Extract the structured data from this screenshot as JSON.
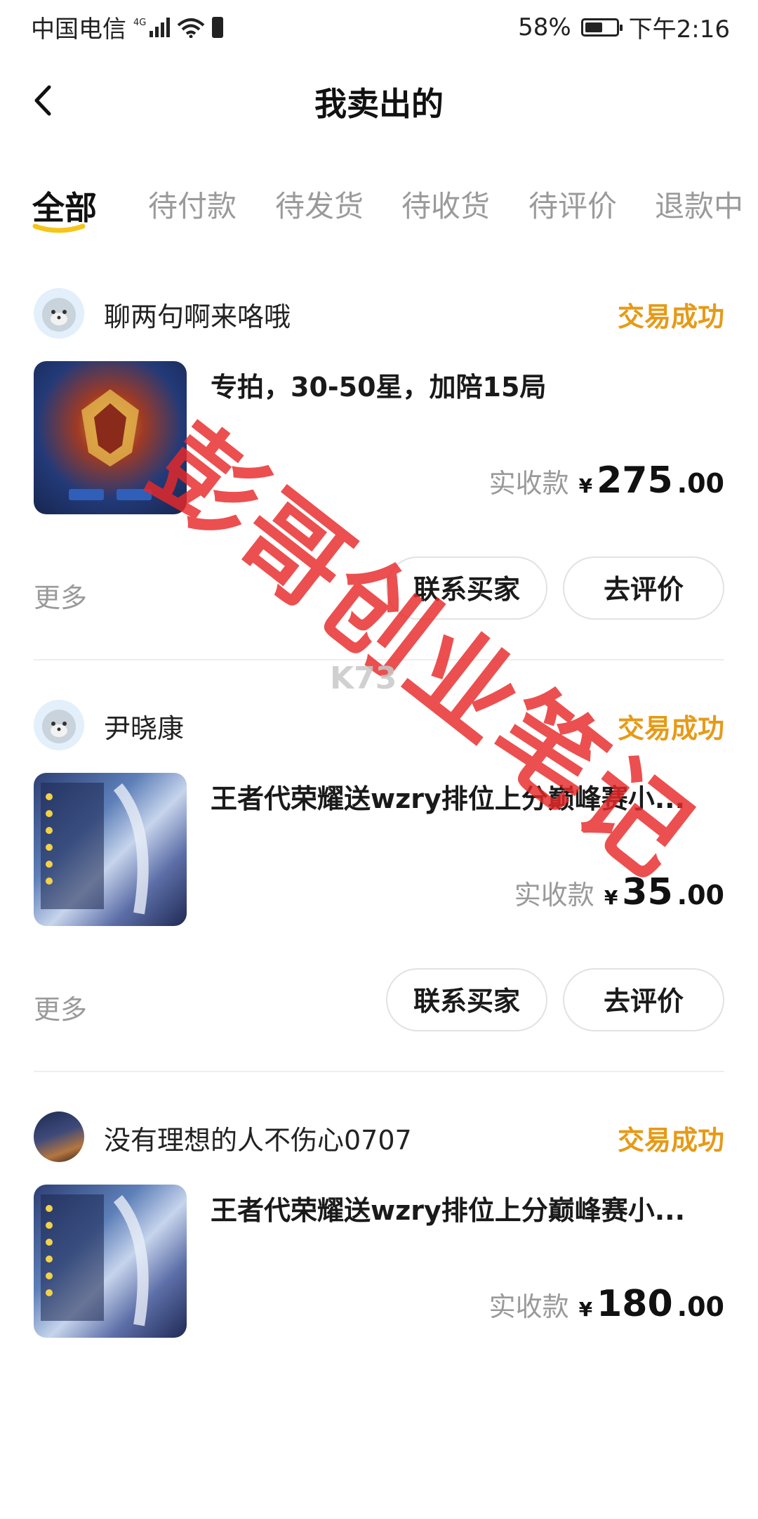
{
  "status_bar": {
    "carrier": "中国电信",
    "network": "4G",
    "battery_percent": "58%",
    "battery_level": 0.58,
    "time": "下午2:16",
    "icons": [
      "signal-icon",
      "wifi-icon",
      "sim-icon",
      "battery-icon"
    ]
  },
  "header": {
    "title": "我卖出的",
    "back_icon": "chevron-left-icon"
  },
  "tabs": [
    {
      "label": "全部",
      "active": true
    },
    {
      "label": "待付款",
      "active": false
    },
    {
      "label": "待发货",
      "active": false
    },
    {
      "label": "待收货",
      "active": false
    },
    {
      "label": "待评价",
      "active": false
    },
    {
      "label": "退款中",
      "active": false
    }
  ],
  "colors": {
    "accent": "#F5C518",
    "status": "#E69A17",
    "watermark": "#E82828"
  },
  "orders": [
    {
      "buyer": "聊两句啊来咯哦",
      "status": "交易成功",
      "title": "专拍，30-50星，加陪15局",
      "price_label": "实收款",
      "currency": "¥",
      "price_int": "275",
      "price_dec": ".00",
      "more": "更多",
      "contact_label": "联系买家",
      "review_label": "去评价"
    },
    {
      "buyer": "尹晓康",
      "status": "交易成功",
      "title": "王者代荣耀送wzry排位上分巅峰赛小...",
      "price_label": "实收款",
      "currency": "¥",
      "price_int": "35",
      "price_dec": ".00",
      "more": "更多",
      "contact_label": "联系买家",
      "review_label": "去评价"
    },
    {
      "buyer": "没有理想的人不伤心0707",
      "status": "交易成功",
      "title": "王者代荣耀送wzry排位上分巅峰赛小...",
      "price_label": "实收款",
      "currency": "¥",
      "price_int": "180",
      "price_dec": ".00",
      "more": "更多",
      "contact_label": "联系买家",
      "review_label": "去评价"
    }
  ],
  "overlay": {
    "watermark_text": "彭哥创业笔记",
    "site_mark": "K73"
  }
}
